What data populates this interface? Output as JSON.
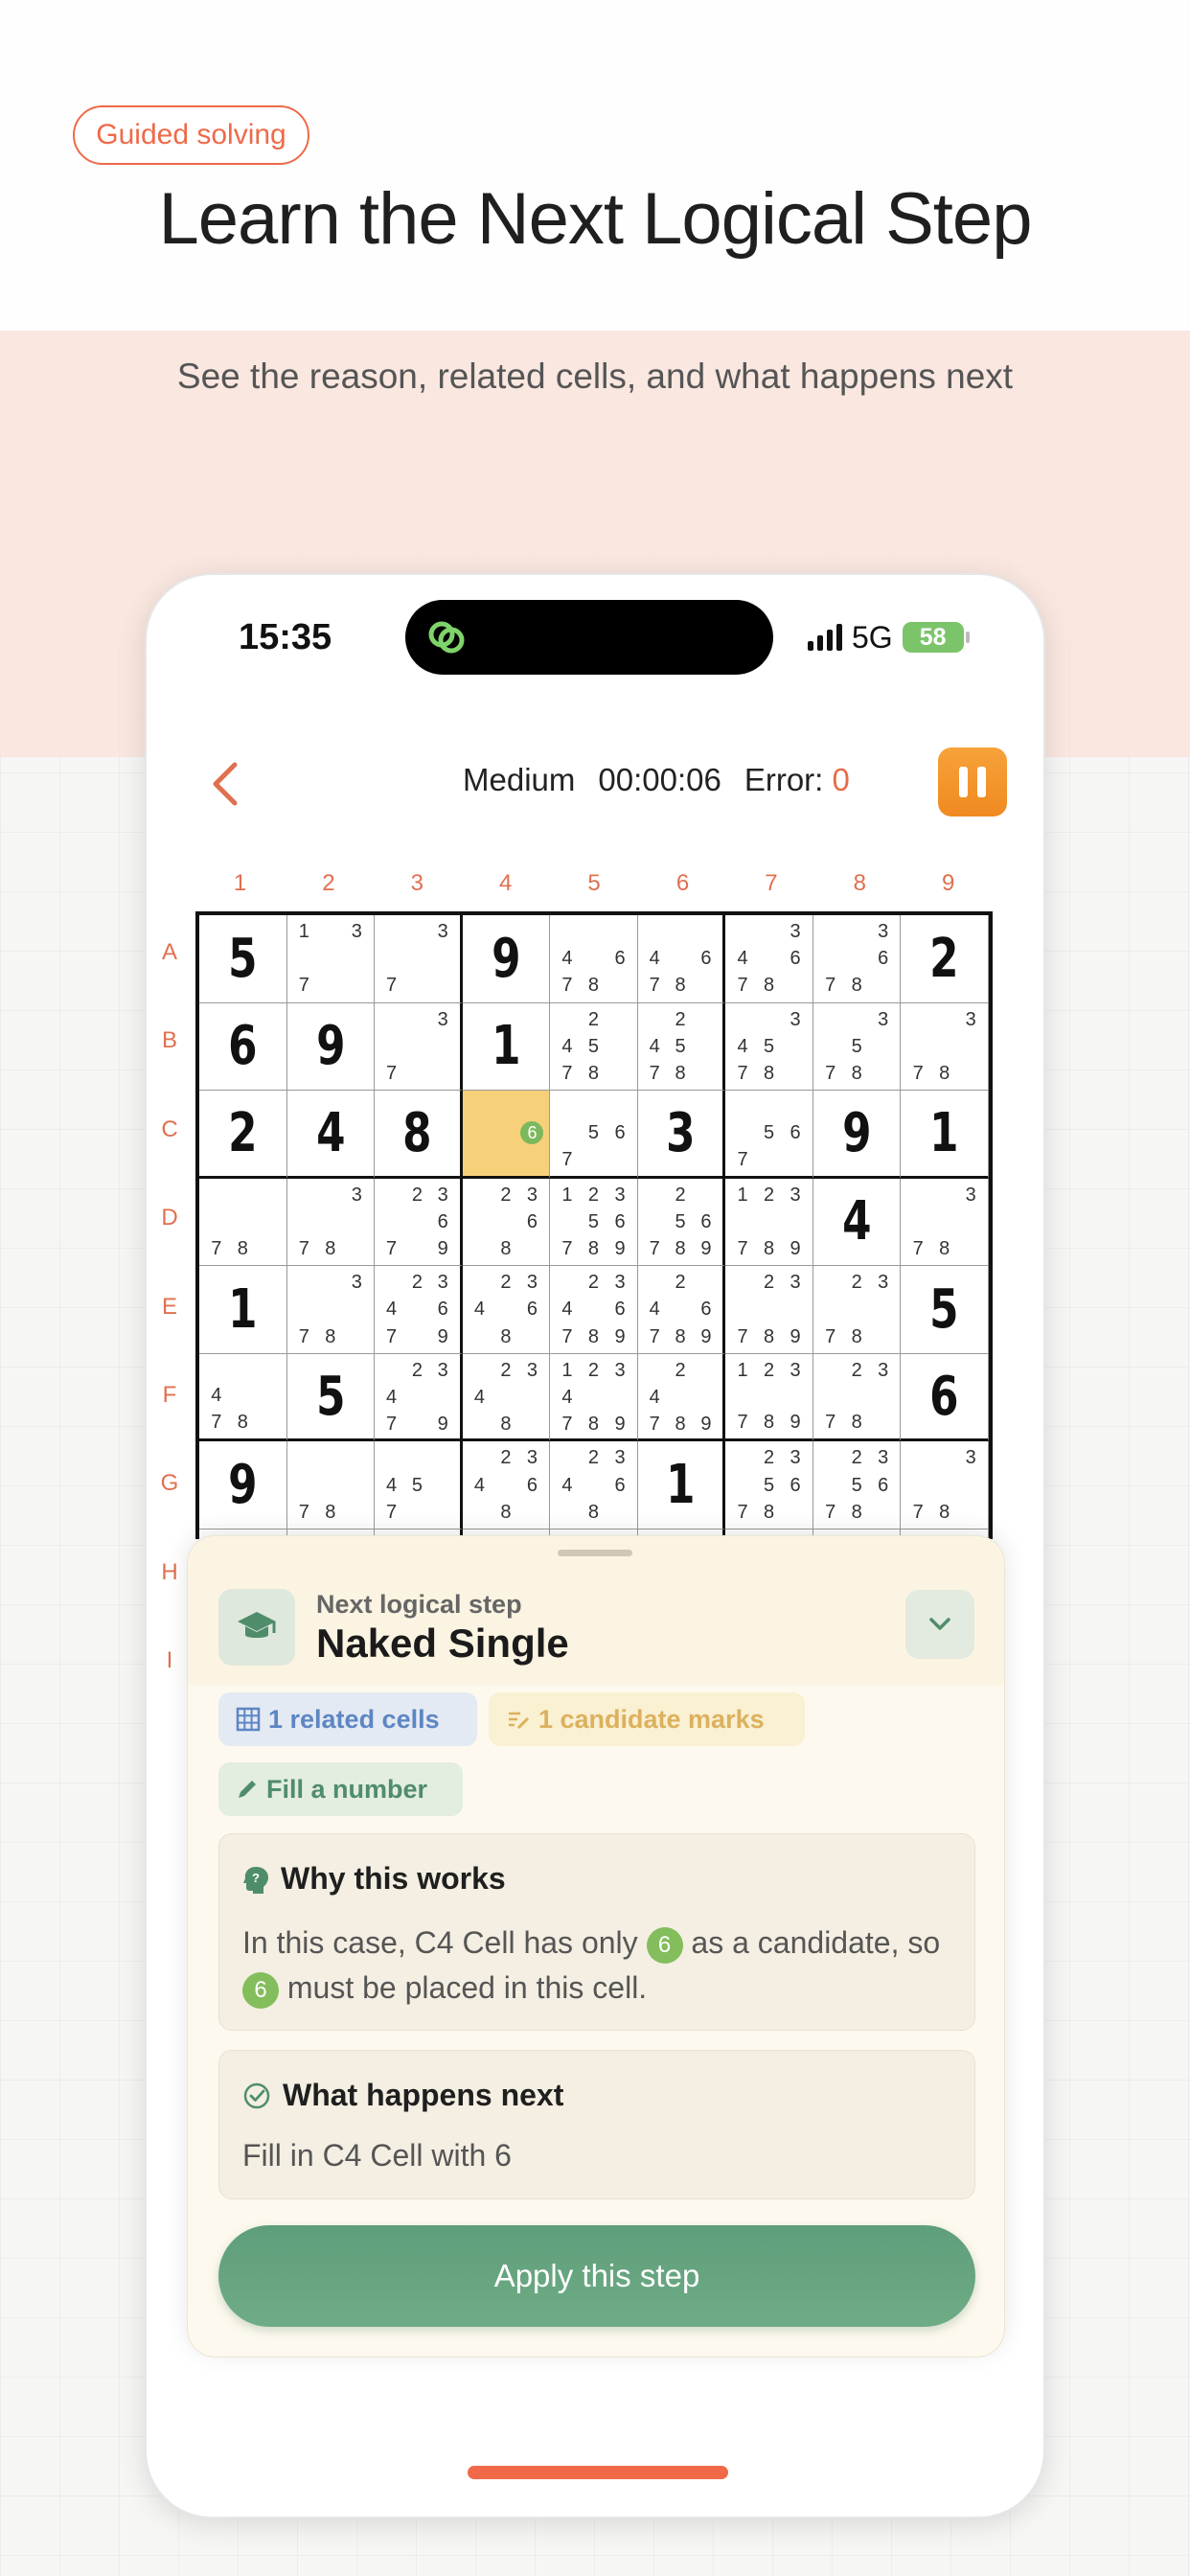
{
  "promo": {
    "badge": "Guided solving",
    "headline": "Learn the Next Logical Step",
    "subheadline": "See the reason, related cells, and what happens next"
  },
  "status_bar": {
    "time": "15:35",
    "network": "5G",
    "battery": "58"
  },
  "game_header": {
    "difficulty": "Medium",
    "timer": "00:00:06",
    "error_label": "Error:",
    "error_value": "0",
    "back_icon": "chevron-left-icon",
    "pause_icon": "pause-icon"
  },
  "board": {
    "col_labels": [
      "1",
      "2",
      "3",
      "4",
      "5",
      "6",
      "7",
      "8",
      "9"
    ],
    "row_labels": [
      "A",
      "B",
      "C",
      "D",
      "E",
      "F",
      "G",
      "H",
      "I"
    ],
    "highlight": "C4",
    "rows": [
      [
        {
          "v": "5"
        },
        {
          "c": [
            1,
            3,
            7
          ]
        },
        {
          "c": [
            3,
            7
          ]
        },
        {
          "v": "9"
        },
        {
          "c": [
            4,
            6,
            7,
            8
          ]
        },
        {
          "c": [
            4,
            6,
            7,
            8
          ]
        },
        {
          "c": [
            3,
            4,
            6,
            7,
            8
          ]
        },
        {
          "c": [
            3,
            6,
            7,
            8
          ]
        },
        {
          "v": "2"
        }
      ],
      [
        {
          "v": "6"
        },
        {
          "v": "9"
        },
        {
          "c": [
            3,
            7
          ]
        },
        {
          "v": "1"
        },
        {
          "c": [
            2,
            4,
            5,
            7,
            8
          ]
        },
        {
          "c": [
            2,
            4,
            5,
            7,
            8
          ]
        },
        {
          "c": [
            3,
            4,
            5,
            7,
            8
          ]
        },
        {
          "c": [
            3,
            5,
            7,
            8
          ]
        },
        {
          "c": [
            3,
            7,
            8
          ]
        }
      ],
      [
        {
          "v": "2"
        },
        {
          "v": "4"
        },
        {
          "v": "8"
        },
        {
          "c": [
            6
          ],
          "hl": true
        },
        {
          "c": [
            5,
            6,
            7
          ]
        },
        {
          "v": "3"
        },
        {
          "c": [
            5,
            6,
            7
          ]
        },
        {
          "v": "9"
        },
        {
          "v": "1"
        }
      ],
      [
        {
          "c": [
            7,
            8
          ]
        },
        {
          "c": [
            3,
            7,
            8
          ]
        },
        {
          "c": [
            2,
            3,
            6,
            7,
            9
          ]
        },
        {
          "c": [
            2,
            3,
            6,
            8
          ]
        },
        {
          "c": [
            1,
            2,
            3,
            5,
            6,
            7,
            8,
            9
          ]
        },
        {
          "c": [
            2,
            5,
            6,
            7,
            8,
            9
          ]
        },
        {
          "c": [
            1,
            2,
            3,
            7,
            8,
            9
          ]
        },
        {
          "v": "4"
        },
        {
          "c": [
            3,
            7,
            8
          ]
        }
      ],
      [
        {
          "v": "1"
        },
        {
          "c": [
            3,
            7,
            8
          ]
        },
        {
          "c": [
            2,
            3,
            4,
            6,
            7,
            9
          ]
        },
        {
          "c": [
            2,
            3,
            4,
            6,
            8
          ]
        },
        {
          "c": [
            2,
            3,
            4,
            6,
            7,
            8,
            9
          ]
        },
        {
          "c": [
            2,
            4,
            6,
            7,
            8,
            9
          ]
        },
        {
          "c": [
            2,
            3,
            7,
            8,
            9
          ]
        },
        {
          "c": [
            2,
            3,
            7,
            8
          ]
        },
        {
          "v": "5"
        }
      ],
      [
        {
          "c": [
            4,
            7,
            8
          ]
        },
        {
          "v": "5"
        },
        {
          "c": [
            2,
            3,
            4,
            7,
            9
          ]
        },
        {
          "c": [
            2,
            3,
            4,
            8
          ]
        },
        {
          "c": [
            1,
            2,
            3,
            4,
            7,
            8,
            9
          ]
        },
        {
          "c": [
            2,
            4,
            7,
            8,
            9
          ]
        },
        {
          "c": [
            1,
            2,
            3,
            7,
            8,
            9
          ]
        },
        {
          "c": [
            2,
            3,
            7,
            8
          ]
        },
        {
          "v": "6"
        }
      ],
      [
        {
          "v": "9"
        },
        {
          "c": [
            7,
            8
          ]
        },
        {
          "c": [
            4,
            5,
            7
          ]
        },
        {
          "c": [
            2,
            3,
            4,
            6,
            8
          ]
        },
        {
          "c": [
            2,
            3,
            4,
            6,
            8
          ]
        },
        {
          "v": "1"
        },
        {
          "c": [
            2,
            3,
            5,
            6,
            7,
            8
          ]
        },
        {
          "c": [
            2,
            3,
            5,
            6,
            7,
            8
          ]
        },
        {
          "c": [
            3,
            7,
            8
          ]
        }
      ],
      [
        {
          "c": []
        },
        {
          "c": []
        },
        {
          "c": []
        },
        {
          "c": []
        },
        {
          "c": []
        },
        {
          "c": []
        },
        {
          "c": []
        },
        {
          "c": []
        },
        {
          "c": []
        }
      ],
      [
        {
          "c": []
        },
        {
          "c": []
        },
        {
          "c": []
        },
        {
          "c": []
        },
        {
          "c": []
        },
        {
          "c": []
        },
        {
          "c": []
        },
        {
          "c": []
        },
        {
          "c": []
        }
      ]
    ]
  },
  "hint_sheet": {
    "kicker": "Next logical step",
    "title": "Naked Single",
    "tags": {
      "related": "1 related cells",
      "candidates": "1 candidate marks",
      "action": "Fill a number"
    },
    "why": {
      "title": "Why this works",
      "text_1": "In this case,  C4 Cell has only",
      "digit": "6",
      "text_2": "as a candidate, so",
      "text_3": "must be placed in this cell."
    },
    "next": {
      "title": "What happens next",
      "text": "Fill in  C4 Cell with 6"
    },
    "apply_label": "Apply this step"
  },
  "colors": {
    "accent": "#e0704f",
    "highlight_cell": "#f7d07a",
    "candidate_green": "#7cb85e",
    "apply_green": "#64a37e",
    "pause_orange": "#f39a2e"
  }
}
